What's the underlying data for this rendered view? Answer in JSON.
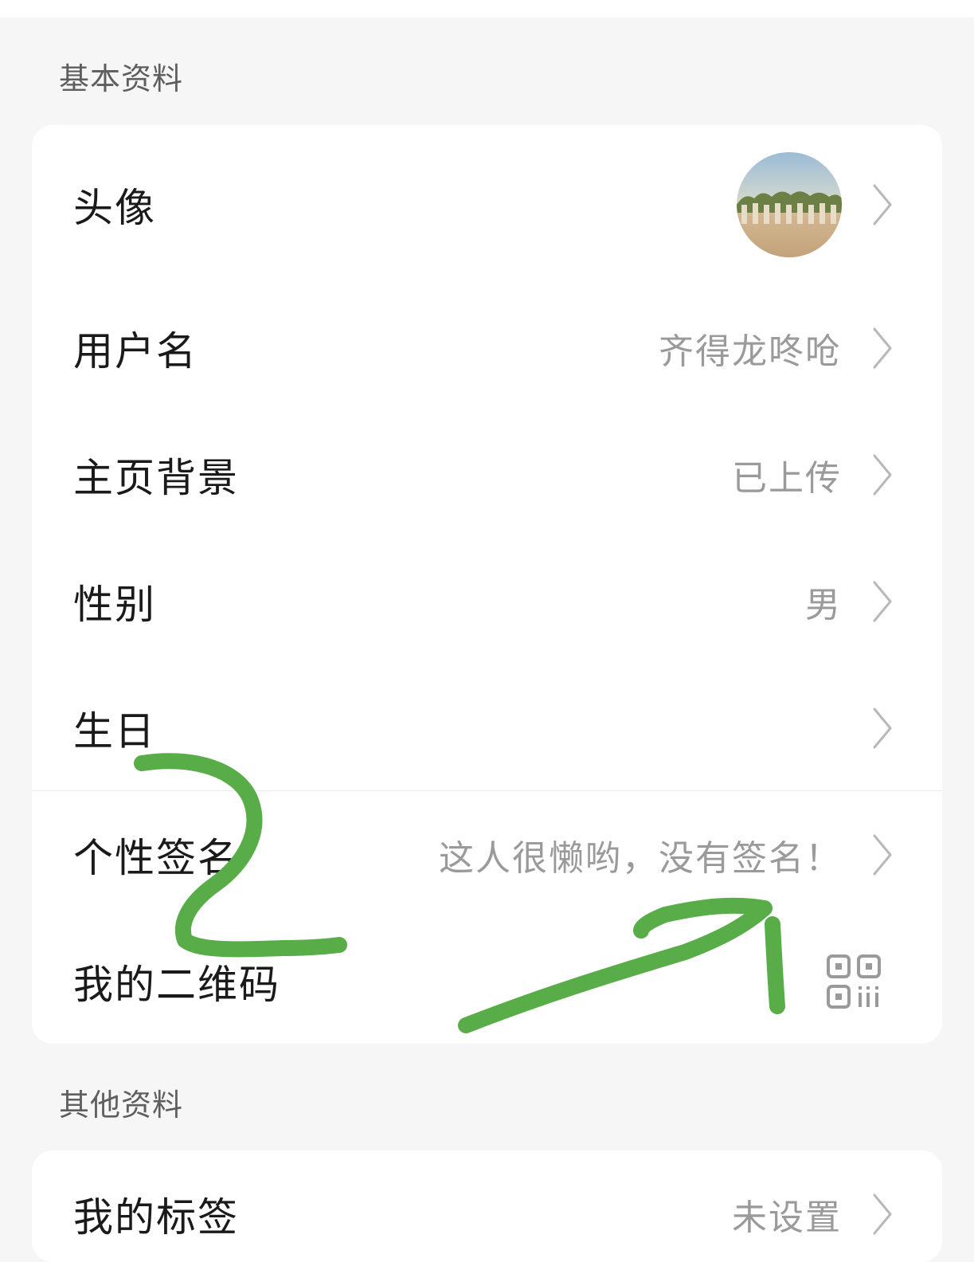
{
  "sections": {
    "basic": {
      "title": "基本资料",
      "rows": {
        "avatar": {
          "label": "头像"
        },
        "username": {
          "label": "用户名",
          "value": "齐得龙咚呛"
        },
        "homepage_bg": {
          "label": "主页背景",
          "value": "已上传"
        },
        "gender": {
          "label": "性别",
          "value": "男"
        },
        "birthday": {
          "label": "生日",
          "value": ""
        },
        "signature": {
          "label": "个性签名",
          "value": "这人很懒哟，没有签名！"
        },
        "qrcode": {
          "label": "我的二维码"
        }
      }
    },
    "other": {
      "title": "其他资料",
      "rows": {
        "tags": {
          "label": "我的标签",
          "value": "未设置"
        }
      }
    }
  },
  "icons": {
    "chevron": "chevron-right-icon",
    "qr": "qr-code-icon",
    "avatar": "avatar-image"
  },
  "colors": {
    "background": "#f6f6f6",
    "card": "#ffffff",
    "label": "#1a1a1a",
    "value": "#9a9a9a",
    "chevron": "#b8b8b8",
    "annotation": "#58ad48"
  }
}
